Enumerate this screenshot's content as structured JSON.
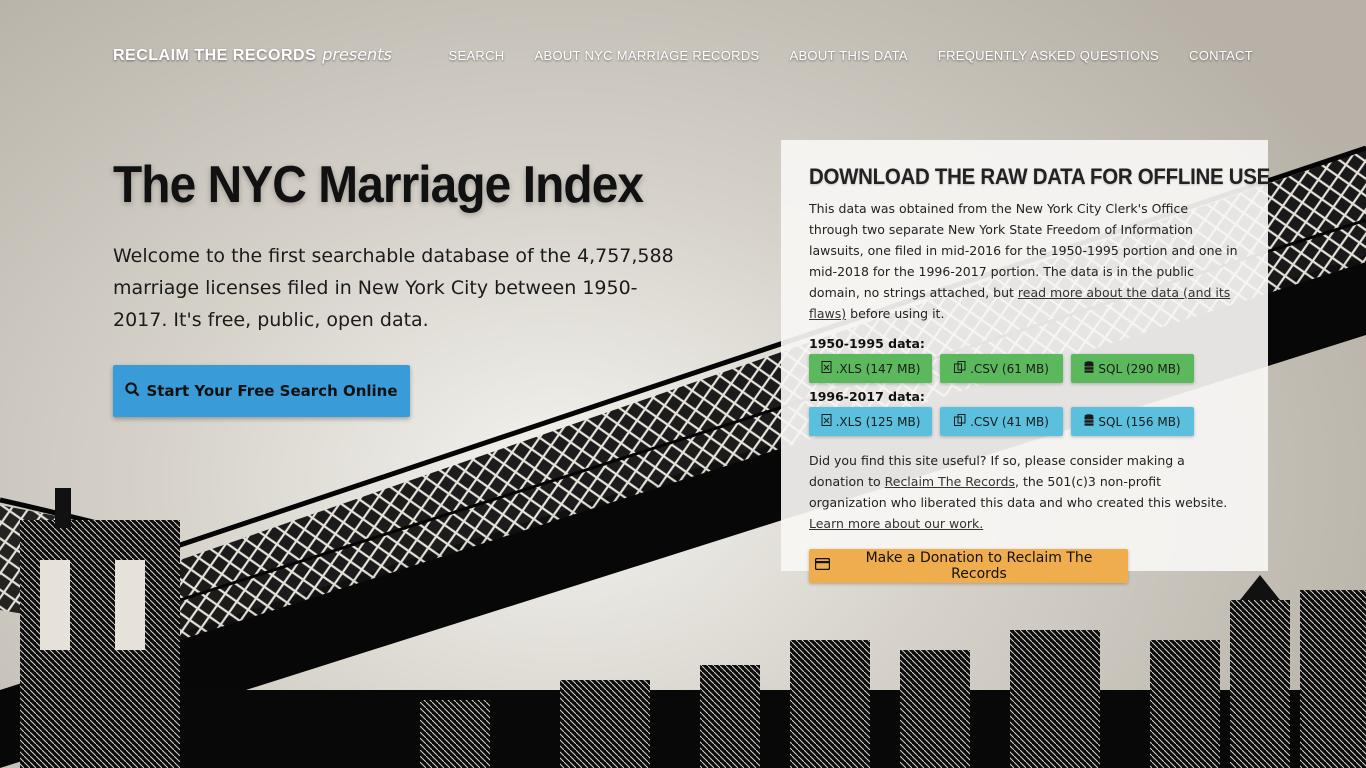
{
  "header": {
    "brand": "RECLAIM THE RECORDS",
    "brand_suffix": "presents",
    "nav": [
      {
        "label": "SEARCH"
      },
      {
        "label": "ABOUT NYC MARRIAGE RECORDS"
      },
      {
        "label": "ABOUT THIS DATA"
      },
      {
        "label": "FREQUENTLY ASKED QUESTIONS"
      },
      {
        "label": "CONTACT"
      }
    ]
  },
  "hero": {
    "title": "The NYC Marriage Index",
    "description": "Welcome to the first searchable database of the 4,757,588 marriage licenses filed in New York City between 1950-2017. It's free, public, open data.",
    "cta_label": "Start Your Free Search Online",
    "cta_icon": "search-icon"
  },
  "download": {
    "heading": "DOWNLOAD THE RAW DATA FOR OFFLINE USE",
    "intro": "This data was obtained from the New York City Clerk's Office through two separate New York State Freedom of Information lawsuits, one filed in mid-2016 for the 1950-1995 portion and one in mid-2018 for the 1996-2017 portion. The data is in the public domain, no strings attached, but",
    "intro_link": "read more about the data (and its flaws)",
    "intro_after": "before using it.",
    "groups": [
      {
        "label": "1950-1995 data:",
        "buttons": [
          {
            "label": ".XLS (147 MB)",
            "icon": "file-excel-icon"
          },
          {
            "label": ".CSV (61 MB)",
            "icon": "copy-icon"
          },
          {
            "label": "SQL (290 MB)",
            "icon": "database-icon"
          }
        ]
      },
      {
        "label": "1996-2017 data:",
        "buttons": [
          {
            "label": ".XLS (125 MB)",
            "icon": "file-excel-icon"
          },
          {
            "label": ".CSV (41 MB)",
            "icon": "copy-icon"
          },
          {
            "label": "SQL (156 MB)",
            "icon": "database-icon"
          }
        ]
      }
    ],
    "donate_before": "Did you find this site useful? If so, please consider making a donation to",
    "donate_link": "Reclaim The Records",
    "donate_middle": ", the 501(c)3 non-profit organization who liberated this data and who created this website.",
    "learn_more_link": "Learn more about our work.",
    "donate_button": "Make a Donation to Reclaim The Records",
    "donate_icon": "credit-card-icon"
  },
  "colors": {
    "cta": "#3a9bd9",
    "green": "#5cb85c",
    "teal": "#5bc0de",
    "orange": "#f0ad4e"
  }
}
